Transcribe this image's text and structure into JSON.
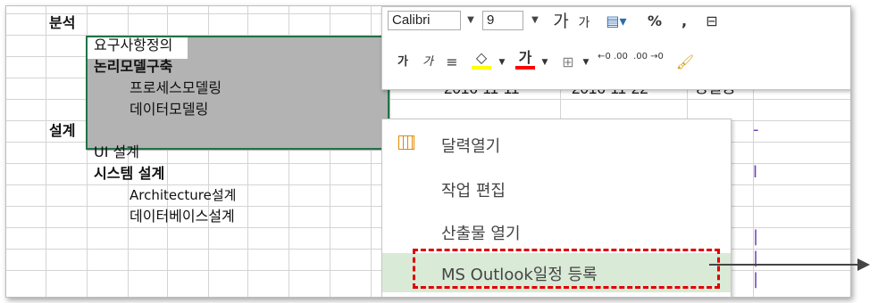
{
  "sheet": {
    "rows": [
      {
        "label": "분석",
        "level": 0,
        "bold": true
      },
      {
        "label": "요구사항정의",
        "level": 1,
        "bold": false
      },
      {
        "label": "논리모델구축",
        "level": 1,
        "bold": true
      },
      {
        "label": "프로세스모델링",
        "level": 2,
        "bold": false
      },
      {
        "label": "데이터모델링",
        "level": 2,
        "bold": false
      },
      {
        "label": "설계",
        "level": 0,
        "bold": true
      },
      {
        "label": "UI 설계",
        "level": 1,
        "bold": false
      },
      {
        "label": "시스템 설계",
        "level": 1,
        "bold": true
      },
      {
        "label": "Architecture설계",
        "level": 2,
        "bold": false
      },
      {
        "label": "데이터베이스설계",
        "level": 2,
        "bold": false
      }
    ],
    "visible_dates": {
      "start": "2016-11-11",
      "end": "2016-11-22"
    },
    "visible_owner": "정길동"
  },
  "toolbar": {
    "font_name": "Calibri",
    "font_size": "9",
    "grow_font": "가",
    "shrink_font": "가",
    "percent": "%",
    "comma": ",",
    "bold_label": "가",
    "italic_label": "가",
    "font_color_letter": "가",
    "decimal_increase": "←0 .00",
    "decimal_decrease": ".00 →0"
  },
  "context_menu": {
    "items": [
      {
        "label": "달력열기",
        "icon": "calendar-icon"
      },
      {
        "label": "작업 편집",
        "icon": ""
      },
      {
        "label": "산출물 열기",
        "icon": ""
      },
      {
        "label": "MS Outlook일정 등록",
        "icon": "",
        "highlighted": true
      }
    ]
  },
  "colors": {
    "selection_border": "#217346",
    "highlight": "#d9ead6",
    "callout": "#e00000",
    "fill_color": "#ffff00",
    "font_color": "#ff0000"
  }
}
